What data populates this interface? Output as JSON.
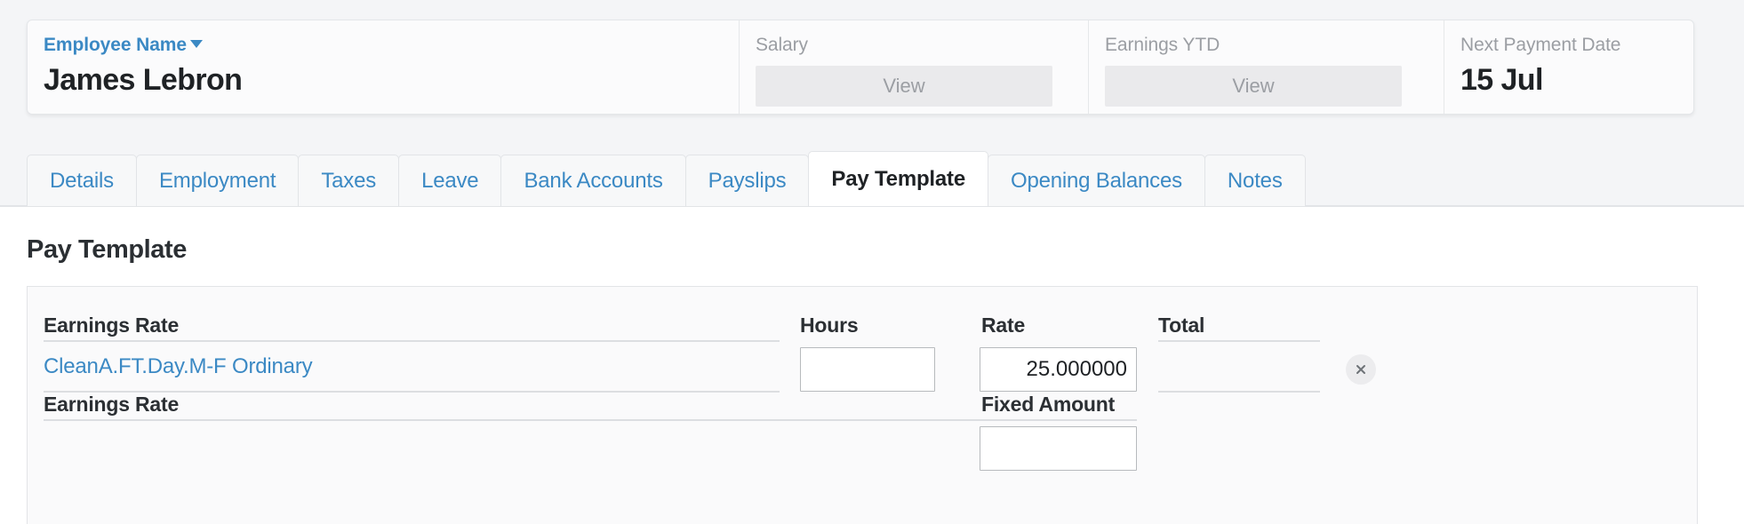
{
  "employee_header": {
    "name_label": "Employee Name",
    "name_value": "James Lebron",
    "salary_label": "Salary",
    "salary_button": "View",
    "earnings_ytd_label": "Earnings YTD",
    "earnings_ytd_button": "View",
    "next_payment_label": "Next Payment Date",
    "next_payment_value": "15 Jul"
  },
  "tabs": [
    {
      "label": "Details",
      "active": false
    },
    {
      "label": "Employment",
      "active": false
    },
    {
      "label": "Taxes",
      "active": false
    },
    {
      "label": "Leave",
      "active": false
    },
    {
      "label": "Bank Accounts",
      "active": false
    },
    {
      "label": "Payslips",
      "active": false
    },
    {
      "label": "Pay Template",
      "active": true
    },
    {
      "label": "Opening Balances",
      "active": false
    },
    {
      "label": "Notes",
      "active": false
    }
  ],
  "section": {
    "title": "Pay Template"
  },
  "pay_template": {
    "row1": {
      "col_earnings_rate": "Earnings Rate",
      "col_hours": "Hours",
      "col_rate": "Rate",
      "col_total": "Total",
      "earnings_rate_value": "CleanA.FT.Day.M-F Ordinary",
      "hours_value": "",
      "hours_placeholder": "",
      "rate_value": "25.000000",
      "total_value": "",
      "remove_icon": "close-icon"
    },
    "row2": {
      "col_earnings_rate": "Earnings Rate",
      "col_fixed_amount": "Fixed Amount",
      "fixed_amount_value": ""
    }
  },
  "colors": {
    "link": "#3b89c4",
    "text": "#1f2225",
    "muted": "#9b9ea3",
    "page_bg": "#f4f5f7",
    "card_bg": "#fafafb"
  }
}
